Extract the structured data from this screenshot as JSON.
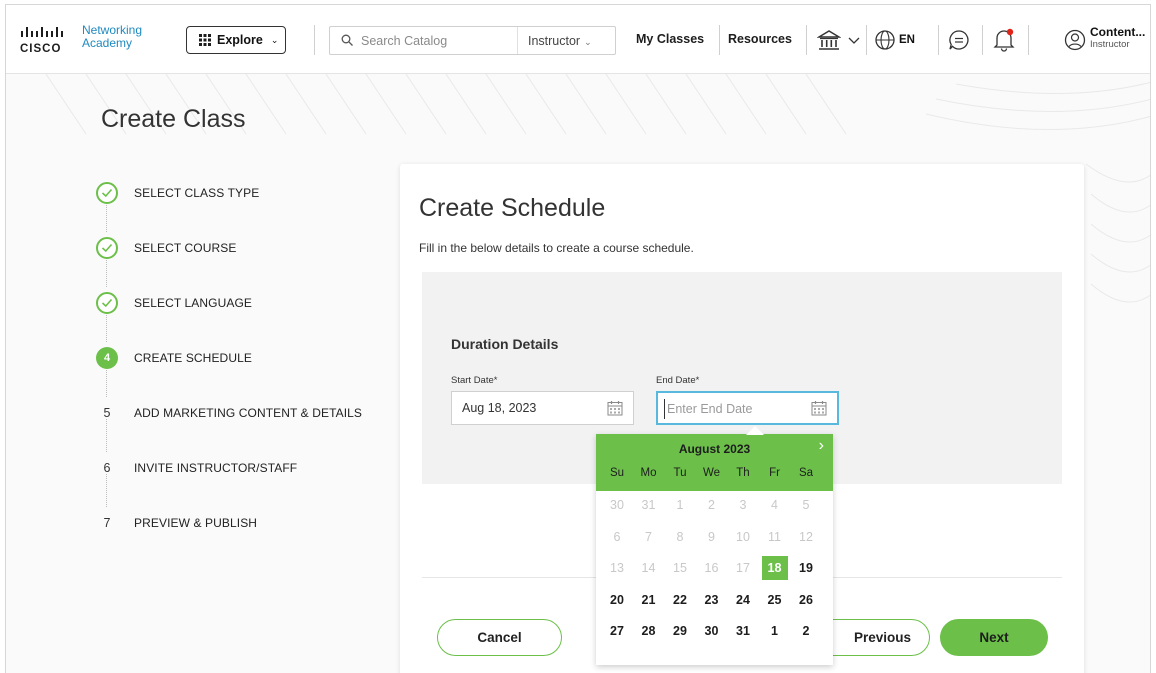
{
  "header": {
    "logo": {
      "brand": "CISCO",
      "name_line1": "Networking",
      "name_line2": "Academy"
    },
    "explore_label": "Explore",
    "search": {
      "placeholder": "Search Catalog"
    },
    "role_select": "Instructor",
    "nav": {
      "my_classes": "My Classes",
      "resources": "Resources"
    },
    "language": "EN",
    "user": {
      "name": "Content...",
      "role": "Instructor"
    },
    "icons": [
      "grid-icon",
      "chevron-down-icon",
      "search-icon",
      "institution-icon",
      "globe-icon",
      "chat-icon",
      "bell-icon",
      "user-icon"
    ],
    "accent": "#1f8ac0"
  },
  "page": {
    "title": "Create Class"
  },
  "steps": [
    {
      "number": "1",
      "label": "SELECT CLASS TYPE",
      "state": "done"
    },
    {
      "number": "2",
      "label": "SELECT COURSE",
      "state": "done"
    },
    {
      "number": "3",
      "label": "SELECT LANGUAGE",
      "state": "done"
    },
    {
      "number": "4",
      "label": "CREATE SCHEDULE",
      "state": "active"
    },
    {
      "number": "5",
      "label": "ADD MARKETING CONTENT & DETAILS",
      "state": "todo"
    },
    {
      "number": "6",
      "label": "INVITE INSTRUCTOR/STAFF",
      "state": "todo"
    },
    {
      "number": "7",
      "label": "PREVIEW & PUBLISH",
      "state": "todo"
    }
  ],
  "card": {
    "title": "Create Schedule",
    "subtitle": "Fill in the below details to create a course schedule.",
    "duration_title": "Duration Details",
    "start_date": {
      "label": "Start Date*",
      "value": "Aug 18, 2023"
    },
    "end_date": {
      "label": "End Date*",
      "placeholder": "Enter End Date"
    },
    "buttons": {
      "cancel": "Cancel",
      "previous": "Previous",
      "next": "Next"
    }
  },
  "calendar": {
    "month_label": "August 2023",
    "next_glyph": "›",
    "weekdays": [
      "Su",
      "Mo",
      "Tu",
      "We",
      "Th",
      "Fr",
      "Sa"
    ],
    "weeks": [
      [
        "30",
        "31",
        "1",
        "2",
        "3",
        "4",
        "5"
      ],
      [
        "6",
        "7",
        "8",
        "9",
        "10",
        "11",
        "12"
      ],
      [
        "13",
        "14",
        "15",
        "16",
        "17",
        "18",
        "19"
      ],
      [
        "20",
        "21",
        "22",
        "23",
        "24",
        "25",
        "26"
      ],
      [
        "27",
        "28",
        "29",
        "30",
        "31",
        "1",
        "2"
      ]
    ],
    "week_states": [
      [
        "off",
        "off",
        "off",
        "off",
        "off",
        "off",
        "off"
      ],
      [
        "off",
        "off",
        "off",
        "off",
        "off",
        "off",
        "off"
      ],
      [
        "off",
        "off",
        "off",
        "off",
        "off",
        "sel",
        "on"
      ],
      [
        "on",
        "on",
        "on",
        "on",
        "on",
        "on",
        "on"
      ],
      [
        "on",
        "on",
        "on",
        "on",
        "on",
        "on",
        "on"
      ]
    ],
    "selected_day": "18"
  },
  "colors": {
    "brand_green": "#6cc04a",
    "focus_blue": "#58b8dd"
  }
}
